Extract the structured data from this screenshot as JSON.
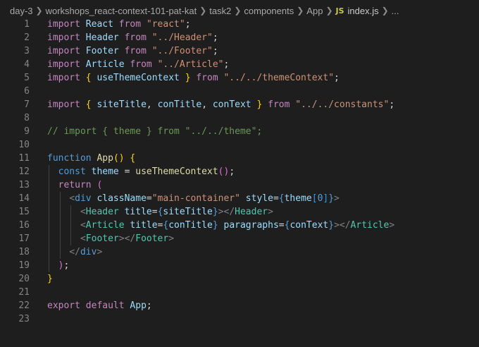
{
  "breadcrumb": {
    "items": [
      "day-3",
      "workshops_react-context-101-pat-kat",
      "task2",
      "components",
      "App"
    ],
    "file_icon": "JS",
    "file": "index.js",
    "trailing": "..."
  },
  "editor": {
    "line_numbers": [
      "1",
      "2",
      "3",
      "4",
      "5",
      "6",
      "7",
      "8",
      "9",
      "10",
      "11",
      "12",
      "13",
      "14",
      "15",
      "16",
      "17",
      "18",
      "19",
      "20",
      "21",
      "22",
      "23"
    ],
    "lines": [
      [
        [
          "kw",
          "import"
        ],
        [
          "df",
          " "
        ],
        [
          "var",
          "React"
        ],
        [
          "df",
          " "
        ],
        [
          "kw",
          "from"
        ],
        [
          "df",
          " "
        ],
        [
          "str",
          "\"react\""
        ],
        [
          "df",
          ";"
        ]
      ],
      [
        [
          "kw",
          "import"
        ],
        [
          "df",
          " "
        ],
        [
          "var",
          "Header"
        ],
        [
          "df",
          " "
        ],
        [
          "kw",
          "from"
        ],
        [
          "df",
          " "
        ],
        [
          "str",
          "\"../Header\""
        ],
        [
          "df",
          ";"
        ]
      ],
      [
        [
          "kw",
          "import"
        ],
        [
          "df",
          " "
        ],
        [
          "var",
          "Footer"
        ],
        [
          "df",
          " "
        ],
        [
          "kw",
          "from"
        ],
        [
          "df",
          " "
        ],
        [
          "str",
          "\"../Footer\""
        ],
        [
          "df",
          ";"
        ]
      ],
      [
        [
          "kw",
          "import"
        ],
        [
          "df",
          " "
        ],
        [
          "var",
          "Article"
        ],
        [
          "df",
          " "
        ],
        [
          "kw",
          "from"
        ],
        [
          "df",
          " "
        ],
        [
          "str",
          "\"../Article\""
        ],
        [
          "df",
          ";"
        ]
      ],
      [
        [
          "kw",
          "import"
        ],
        [
          "df",
          " "
        ],
        [
          "b1",
          "{"
        ],
        [
          "df",
          " "
        ],
        [
          "var",
          "useThemeContext"
        ],
        [
          "df",
          " "
        ],
        [
          "b1",
          "}"
        ],
        [
          "df",
          " "
        ],
        [
          "kw",
          "from"
        ],
        [
          "df",
          " "
        ],
        [
          "str",
          "\"../../themeContext\""
        ],
        [
          "df",
          ";"
        ]
      ],
      [],
      [
        [
          "kw",
          "import"
        ],
        [
          "df",
          " "
        ],
        [
          "b1",
          "{"
        ],
        [
          "df",
          " "
        ],
        [
          "var",
          "siteTitle"
        ],
        [
          "df",
          ", "
        ],
        [
          "var",
          "conTitle"
        ],
        [
          "df",
          ", "
        ],
        [
          "var",
          "conText"
        ],
        [
          "df",
          " "
        ],
        [
          "b1",
          "}"
        ],
        [
          "df",
          " "
        ],
        [
          "kw",
          "from"
        ],
        [
          "df",
          " "
        ],
        [
          "str",
          "\"../../constants\""
        ],
        [
          "df",
          ";"
        ]
      ],
      [],
      [
        [
          "cm",
          "// import { theme } from \"../../theme\";"
        ]
      ],
      [],
      [
        [
          "st",
          "function"
        ],
        [
          "df",
          " "
        ],
        [
          "fn",
          "App"
        ],
        [
          "b1",
          "()"
        ],
        [
          "df",
          " "
        ],
        [
          "b1",
          "{"
        ]
      ],
      [
        [
          "df",
          "  "
        ],
        [
          "st",
          "const"
        ],
        [
          "df",
          " "
        ],
        [
          "var",
          "theme"
        ],
        [
          "df",
          " = "
        ],
        [
          "fn",
          "useThemeContext"
        ],
        [
          "b2",
          "()"
        ],
        [
          "df",
          ";"
        ]
      ],
      [
        [
          "df",
          "  "
        ],
        [
          "kw",
          "return"
        ],
        [
          "df",
          " "
        ],
        [
          "b2",
          "("
        ]
      ],
      [
        [
          "df",
          "    "
        ],
        [
          "pu",
          "<"
        ],
        [
          "st",
          "div"
        ],
        [
          "df",
          " "
        ],
        [
          "var",
          "className"
        ],
        [
          "df",
          "="
        ],
        [
          "str",
          "\"main-container\""
        ],
        [
          "df",
          " "
        ],
        [
          "var",
          "style"
        ],
        [
          "df",
          "="
        ],
        [
          "st",
          "{"
        ],
        [
          "var",
          "theme"
        ],
        [
          "b3",
          "["
        ],
        [
          "st",
          "0"
        ],
        [
          "b3",
          "]"
        ],
        [
          "st",
          "}"
        ],
        [
          "pu",
          ">"
        ]
      ],
      [
        [
          "df",
          "      "
        ],
        [
          "pu",
          "<"
        ],
        [
          "tag",
          "Header"
        ],
        [
          "df",
          " "
        ],
        [
          "var",
          "title"
        ],
        [
          "df",
          "="
        ],
        [
          "st",
          "{"
        ],
        [
          "var",
          "siteTitle"
        ],
        [
          "st",
          "}"
        ],
        [
          "pu",
          "></"
        ],
        [
          "tag",
          "Header"
        ],
        [
          "pu",
          ">"
        ]
      ],
      [
        [
          "df",
          "      "
        ],
        [
          "pu",
          "<"
        ],
        [
          "tag",
          "Article"
        ],
        [
          "df",
          " "
        ],
        [
          "var",
          "title"
        ],
        [
          "df",
          "="
        ],
        [
          "st",
          "{"
        ],
        [
          "var",
          "conTitle"
        ],
        [
          "st",
          "}"
        ],
        [
          "df",
          " "
        ],
        [
          "var",
          "paragraphs"
        ],
        [
          "df",
          "="
        ],
        [
          "st",
          "{"
        ],
        [
          "var",
          "conText"
        ],
        [
          "st",
          "}"
        ],
        [
          "pu",
          "></"
        ],
        [
          "tag",
          "Article"
        ],
        [
          "pu",
          ">"
        ]
      ],
      [
        [
          "df",
          "      "
        ],
        [
          "pu",
          "<"
        ],
        [
          "tag",
          "Footer"
        ],
        [
          "pu",
          "></"
        ],
        [
          "tag",
          "Footer"
        ],
        [
          "pu",
          ">"
        ]
      ],
      [
        [
          "df",
          "    "
        ],
        [
          "pu",
          "</"
        ],
        [
          "st",
          "div"
        ],
        [
          "pu",
          ">"
        ]
      ],
      [
        [
          "df",
          "  "
        ],
        [
          "b2",
          ")"
        ],
        [
          "df",
          ";"
        ]
      ],
      [
        [
          "b1",
          "}"
        ]
      ],
      [],
      [
        [
          "kw",
          "export"
        ],
        [
          "df",
          " "
        ],
        [
          "kw",
          "default"
        ],
        [
          "df",
          " "
        ],
        [
          "var",
          "App"
        ],
        [
          "df",
          ";"
        ]
      ],
      []
    ]
  },
  "colors": {
    "background": "#1e1e1e",
    "line_number": "#858585",
    "keyword_control": "#c586c0",
    "keyword_storage": "#569cd6",
    "variable": "#9cdcfe",
    "string": "#ce9178",
    "function": "#dcdcaa",
    "component": "#4ec9b0",
    "comment": "#6a9955",
    "js_icon": "#cbcb41"
  },
  "icons": [
    "chevron-right-icon",
    "js-file-icon"
  ]
}
